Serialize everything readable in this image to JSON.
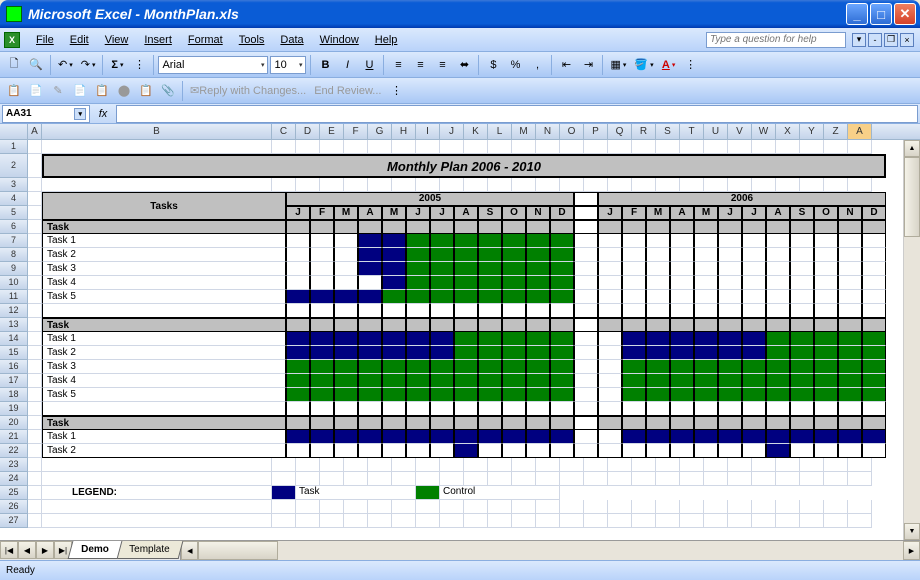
{
  "titlebar": {
    "title": "Microsoft Excel - MonthPlan.xls"
  },
  "menu": {
    "items": [
      "File",
      "Edit",
      "View",
      "Insert",
      "Format",
      "Tools",
      "Data",
      "Window",
      "Help"
    ],
    "question_placeholder": "Type a question for help"
  },
  "toolbar": {
    "font": "Arial",
    "size": "10",
    "reply": "Reply with Changes...",
    "end_review": "End Review..."
  },
  "namebox": "AA31",
  "columns": {
    "A": "A",
    "B": "B",
    "narrow": [
      "C",
      "D",
      "E",
      "F",
      "G",
      "H",
      "I",
      "J",
      "K",
      "L",
      "M",
      "N",
      "O",
      "P",
      "Q",
      "R",
      "S",
      "T",
      "U",
      "V",
      "W",
      "X",
      "Y",
      "Z",
      "AA"
    ]
  },
  "rows_visible": 27,
  "sheet": {
    "title": "Monthly Plan 2006 - 2010",
    "tasks_header": "Tasks",
    "year1": "2005",
    "year2": "2006",
    "months": [
      "J",
      "F",
      "M",
      "A",
      "M",
      "J",
      "J",
      "A",
      "S",
      "O",
      "N",
      "D"
    ],
    "group1": {
      "header": "Task",
      "rows": [
        "Task 1",
        "Task 2",
        "Task 3",
        "Task 4",
        "Task 5"
      ]
    },
    "group2": {
      "header": "Task",
      "rows": [
        "Task 1",
        "Task 2",
        "Task 3",
        "Task 4",
        "Task 5"
      ]
    },
    "group3": {
      "header": "Task",
      "rows": [
        "Task 1",
        "Task 2"
      ]
    },
    "legend": {
      "label": "LEGEND:",
      "task": "Task",
      "control": "Control"
    }
  },
  "chart_data": {
    "type": "table",
    "title": "Monthly Plan 2006 - 2010",
    "columns_year1": "2005",
    "columns_year2": "2006",
    "months": [
      "J",
      "F",
      "M",
      "A",
      "M",
      "J",
      "J",
      "A",
      "S",
      "O",
      "N",
      "D"
    ],
    "legend": {
      "blue": "Task",
      "green": "Control"
    },
    "groups": [
      {
        "name": "Task (group 1)",
        "rows": [
          {
            "name": "Task 1",
            "cells_2005": [
              "",
              "",
              "",
              "blue",
              "blue",
              "green",
              "green",
              "green",
              "green",
              "green",
              "green",
              "green"
            ],
            "cells_2006": [
              "",
              "",
              "",
              "",
              "",
              "",
              "",
              "",
              "",
              "",
              "",
              ""
            ]
          },
          {
            "name": "Task 2",
            "cells_2005": [
              "",
              "",
              "",
              "blue",
              "blue",
              "green",
              "green",
              "green",
              "green",
              "green",
              "green",
              "green"
            ],
            "cells_2006": [
              "",
              "",
              "",
              "",
              "",
              "",
              "",
              "",
              "",
              "",
              "",
              ""
            ]
          },
          {
            "name": "Task 3",
            "cells_2005": [
              "",
              "",
              "",
              "blue",
              "blue",
              "green",
              "green",
              "green",
              "green",
              "green",
              "green",
              "green"
            ],
            "cells_2006": [
              "",
              "",
              "",
              "",
              "",
              "",
              "",
              "",
              "",
              "",
              "",
              ""
            ]
          },
          {
            "name": "Task 4",
            "cells_2005": [
              "",
              "",
              "",
              "",
              "blue",
              "green",
              "green",
              "green",
              "green",
              "green",
              "green",
              "green"
            ],
            "cells_2006": [
              "",
              "",
              "",
              "",
              "",
              "",
              "",
              "",
              "",
              "",
              "",
              ""
            ]
          },
          {
            "name": "Task 5",
            "cells_2005": [
              "blue",
              "blue",
              "blue",
              "blue",
              "green",
              "green",
              "green",
              "green",
              "green",
              "green",
              "green",
              "green"
            ],
            "cells_2006": [
              "",
              "",
              "",
              "",
              "",
              "",
              "",
              "",
              "",
              "",
              "",
              ""
            ]
          }
        ]
      },
      {
        "name": "Task (group 2)",
        "rows": [
          {
            "name": "Task 1",
            "cells_2005": [
              "blue",
              "blue",
              "blue",
              "blue",
              "blue",
              "blue",
              "blue",
              "green",
              "green",
              "green",
              "green",
              "green"
            ],
            "cells_2006": [
              "",
              "blue",
              "blue",
              "blue",
              "blue",
              "blue",
              "blue",
              "green",
              "green",
              "green",
              "green",
              "green"
            ]
          },
          {
            "name": "Task 2",
            "cells_2005": [
              "blue",
              "blue",
              "blue",
              "blue",
              "blue",
              "blue",
              "blue",
              "green",
              "green",
              "green",
              "green",
              "green"
            ],
            "cells_2006": [
              "",
              "blue",
              "blue",
              "blue",
              "blue",
              "blue",
              "blue",
              "green",
              "green",
              "green",
              "green",
              "green"
            ]
          },
          {
            "name": "Task 3",
            "cells_2005": [
              "green",
              "green",
              "green",
              "green",
              "green",
              "green",
              "green",
              "green",
              "green",
              "green",
              "green",
              "green"
            ],
            "cells_2006": [
              "",
              "green",
              "green",
              "green",
              "green",
              "green",
              "green",
              "green",
              "green",
              "green",
              "green",
              "green"
            ]
          },
          {
            "name": "Task 4",
            "cells_2005": [
              "green",
              "green",
              "green",
              "green",
              "green",
              "green",
              "green",
              "green",
              "green",
              "green",
              "green",
              "green"
            ],
            "cells_2006": [
              "",
              "green",
              "green",
              "green",
              "green",
              "green",
              "green",
              "green",
              "green",
              "green",
              "green",
              "green"
            ]
          },
          {
            "name": "Task 5",
            "cells_2005": [
              "green",
              "green",
              "green",
              "green",
              "green",
              "green",
              "green",
              "green",
              "green",
              "green",
              "green",
              "green"
            ],
            "cells_2006": [
              "",
              "green",
              "green",
              "green",
              "green",
              "green",
              "green",
              "green",
              "green",
              "green",
              "green",
              "green"
            ]
          }
        ]
      },
      {
        "name": "Task (group 3)",
        "rows": [
          {
            "name": "Task 1",
            "cells_2005": [
              "blue",
              "blue",
              "blue",
              "blue",
              "blue",
              "blue",
              "blue",
              "blue",
              "blue",
              "blue",
              "blue",
              "blue"
            ],
            "cells_2006": [
              "",
              "blue",
              "blue",
              "blue",
              "blue",
              "blue",
              "blue",
              "blue",
              "blue",
              "blue",
              "blue",
              "blue"
            ]
          },
          {
            "name": "Task 2",
            "cells_2005": [
              "",
              "",
              "",
              "",
              "",
              "",
              "",
              "blue",
              "",
              "",
              "",
              ""
            ],
            "cells_2006": [
              "",
              "",
              "",
              "",
              "",
              "",
              "",
              "blue",
              "",
              "",
              "",
              ""
            ]
          }
        ]
      }
    ]
  },
  "tabs": {
    "active": "Demo",
    "other": "Template"
  },
  "status": "Ready"
}
